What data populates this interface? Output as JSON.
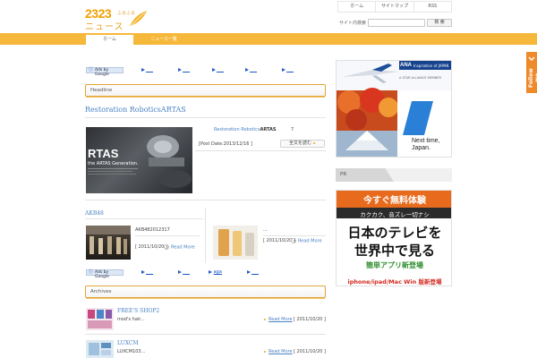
{
  "header": {
    "logo_num": "2323",
    "logo_kana": "ふるふる",
    "logo_jp": "ニュース",
    "top_links": [
      "ホーム",
      "サイトマップ",
      "RSS"
    ],
    "search_label": "サイト内検索",
    "search_value": "",
    "search_button": "検 索"
  },
  "nav": {
    "tabs": [
      "ホーム",
      "ニュース一覧"
    ]
  },
  "follow": {
    "label": "Follow me"
  },
  "ads": {
    "badge": "Ads by Google",
    "top_links": [
      "",
      "",
      "",
      "",
      ""
    ],
    "bottom_links": [
      "",
      "",
      "aga",
      ""
    ]
  },
  "headline": {
    "heading": "Headline",
    "title": "Restoration RoboticsARTAS",
    "source_prefix": "Restoration Robotics",
    "source_bold": "ARTAS",
    "count": "7",
    "post_date": "[Post Date:2013/12/16 ]",
    "read_button": "全文を読む",
    "image_text_big": "RTAS",
    "image_text_sub": "the ARTAS Generation."
  },
  "akb": {
    "section_title": "AKB48",
    "left": {
      "title": "AKB482012317",
      "date": "[ 2011/10/20 ]",
      "more": "Read More"
    },
    "right": {
      "title": "...",
      "date": "[ 2011/10/20 ]",
      "more": "Read More"
    }
  },
  "archives": {
    "heading": "Archives",
    "items": [
      {
        "title": "FREE'S SHOP2",
        "excerpt": "mod's hair...",
        "more": "Read More",
        "date": "[ 2011/10/20 ]"
      },
      {
        "title": "LUXCM",
        "excerpt": "LUXCM103...",
        "more": "Read More",
        "date": "[ 2011/10/20 ]"
      }
    ]
  },
  "sidebar": {
    "ad1": {
      "brand": "ANA",
      "brand_tag": "Inspiration of JAPAN",
      "alliance": "A STAR ALLIANCE MEMBER",
      "headline": "Next time, Japan."
    },
    "pr_label": "PR",
    "ad2": {
      "line1": "今すぐ無料体験",
      "line2": "カクカク、音ズレ一切ナシ",
      "line3": "日本のテレビを",
      "line4": "世界中で見る",
      "line5": "簡単アプリ新登場",
      "line6": "iphone/ipad/Mac Win 版新登場"
    }
  },
  "colors": {
    "accent": "#f6b83a",
    "link": "#4a82c3",
    "follow": "#ef8a2b"
  }
}
